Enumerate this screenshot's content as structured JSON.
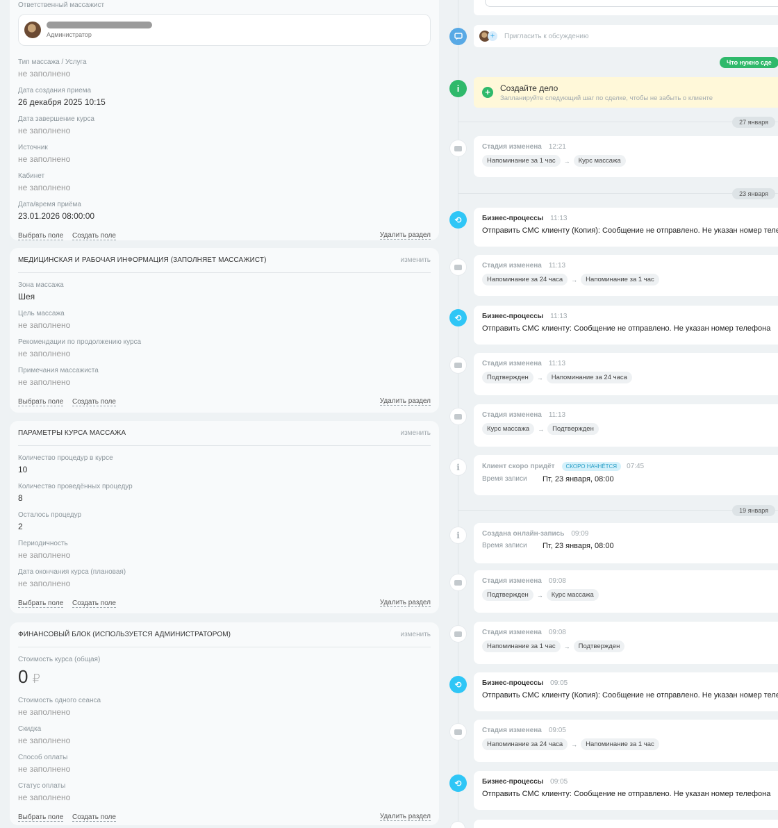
{
  "main_card": {
    "responsible_label": "Ответственный массажист",
    "user_role": "Администратор",
    "fields": [
      {
        "label": "Тип массажа / Услуга",
        "value": "не заполнено"
      },
      {
        "label": "Дата создания приема",
        "value": "26 декабря 2025 10:15"
      },
      {
        "label": "Дата завершение курса",
        "value": "не заполнено"
      },
      {
        "label": "Источник",
        "value": "не заполнено"
      },
      {
        "label": "Кабинет",
        "value": "не заполнено"
      },
      {
        "label": "Дата/время приёма",
        "value": "23.01.2026 08:00:00"
      }
    ]
  },
  "footer": {
    "choose_field": "Выбрать поле",
    "create_field": "Создать поле",
    "delete_section": "Удалить раздел"
  },
  "edit_label": "изменить",
  "medical_card": {
    "title": "МЕДИЦИНСКАЯ И РАБОЧАЯ ИНФОРМАЦИЯ (ЗАПОЛНЯЕТ МАССАЖИСТ)",
    "fields": [
      {
        "label": "Зона массажа",
        "value": "Шея"
      },
      {
        "label": "Цель массажа",
        "value": "не заполнено"
      },
      {
        "label": "Рекомендации по продолжению курса",
        "value": "не заполнено"
      },
      {
        "label": "Примечания массажиста",
        "value": "не заполнено"
      }
    ]
  },
  "params_card": {
    "title": "ПАРАМЕТРЫ КУРСА МАССАЖА",
    "fields": [
      {
        "label": "Количество процедур в курсе",
        "value": "10"
      },
      {
        "label": "Количество проведённых процедур",
        "value": "8"
      },
      {
        "label": "Осталось процедур",
        "value": "2"
      },
      {
        "label": "Периодичность",
        "value": "не заполнено"
      },
      {
        "label": "Дата окончания курса (плановая)",
        "value": "не заполнено"
      }
    ]
  },
  "finance_card": {
    "title": "ФИНАНСОВЫЙ БЛОК (ИСПОЛЬЗУЕТСЯ АДМИНИСТРАТОРОМ)",
    "cost_label": "Стоимость курса (общая)",
    "cost_value": "0",
    "currency": "₽",
    "fields": [
      {
        "label": "Стоимость одного сеанса",
        "value": "не заполнено"
      },
      {
        "label": "Скидка",
        "value": "не заполнено"
      },
      {
        "label": "Способ оплаты",
        "value": "не заполнено"
      },
      {
        "label": "Статус оплаты",
        "value": "не заполнено"
      }
    ]
  },
  "timeline": {
    "invite_text": "Пригласить к обсуждению",
    "todo_pill": "Что нужно сде",
    "create_deal_title": "Создайте дело",
    "create_deal_sub": "Запланируйте следующий шаг по сделке, чтобы не забыть о клиенте",
    "dates": [
      "27 января",
      "23 января",
      "19 января"
    ],
    "stage_title": "Стадия изменена",
    "bp_title": "Бизнес-процессы",
    "arrow": "→",
    "items": {
      "s1": {
        "time": "12:21",
        "from": "Напоминание за 1 час",
        "to": "Курс массажа"
      },
      "b1": {
        "time": "11:13",
        "prefix": "Отправить СМС клиенту (Копия):",
        "text": "Сообщение не отправлено. Не указан номер теле"
      },
      "s2": {
        "time": "11:13",
        "from": "Напоминание за 24 часа",
        "to": "Напоминание за 1 час"
      },
      "b2": {
        "time": "11:13",
        "prefix": "Отправить СМС клиенту:",
        "text": "Сообщение не отправлено. Не указан номер телефона"
      },
      "s3": {
        "time": "11:13",
        "from": "Подтвержден",
        "to": "Напоминание за 24 часа"
      },
      "s4": {
        "time": "11:13",
        "from": "Курс массажа",
        "to": "Подтвержден"
      },
      "c1": {
        "title": "Клиент скоро придёт",
        "badge": "скоро начнётся",
        "time": "07:45",
        "rec_label": "Время записи",
        "rec_value": "Пт, 23 января, 08:00"
      },
      "c2": {
        "title": "Создана онлайн-запись",
        "time": "09:09",
        "rec_label": "Время записи",
        "rec_value": "Пт, 23 января, 08:00"
      },
      "s5": {
        "time": "09:08",
        "from": "Подтвержден",
        "to": "Курс массажа"
      },
      "s6": {
        "time": "09:08",
        "from": "Напоминание за 1 час",
        "to": "Подтвержден"
      },
      "b3": {
        "time": "09:05",
        "prefix": "Отправить СМС клиенту (Копия):",
        "text": "Сообщение не отправлено. Не указан номер теле"
      },
      "s7": {
        "time": "09:05",
        "from": "Напоминание за 24 часа",
        "to": "Напоминание за 1 час"
      },
      "b4": {
        "time": "09:05",
        "prefix": "Отправить СМС клиенту:",
        "text": "Сообщение не отправлено. Не указан номер телефона"
      }
    }
  }
}
